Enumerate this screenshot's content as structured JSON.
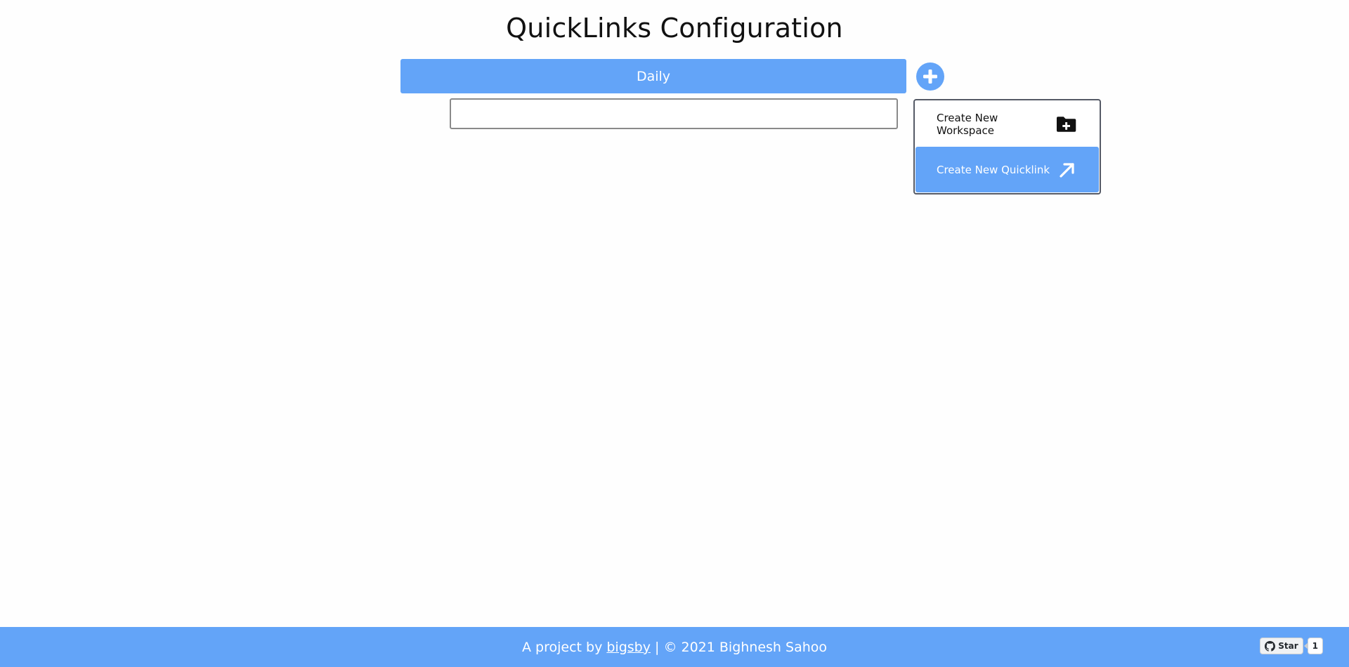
{
  "page": {
    "title": "QuickLinks Configuration"
  },
  "workspace": {
    "tab_label": "Daily"
  },
  "add_button": {
    "icon": "plus-icon"
  },
  "quicklink_input": {
    "value": "",
    "placeholder": ""
  },
  "menu": {
    "items": [
      {
        "label": "Create New Workspace",
        "icon": "folder-plus-icon",
        "active": false
      },
      {
        "label": "Create New Quicklink",
        "icon": "arrow-up-right-icon",
        "active": true
      }
    ]
  },
  "footer": {
    "prefix": "A project by ",
    "link_text": "bigsby",
    "suffix": " | © 2021 Bighnesh Sahoo"
  },
  "github": {
    "star_label": "Star",
    "star_count": "1"
  },
  "colors": {
    "accent": "#63a4f8",
    "text": "#111111",
    "background": "#fefefe"
  }
}
